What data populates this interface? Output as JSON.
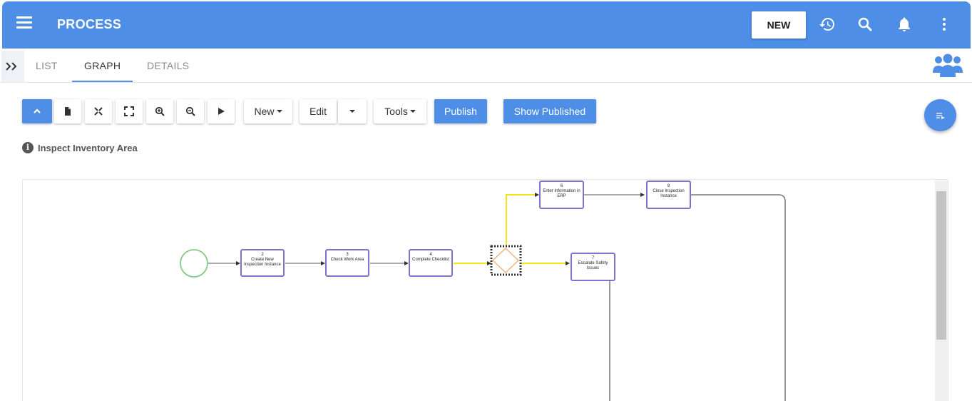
{
  "app": {
    "title": "PROCESS",
    "new_label": "NEW",
    "accent_color": "#4e8ee6",
    "icons": [
      "menu-icon",
      "history-icon",
      "search-icon",
      "bell-icon",
      "more-vert-icon"
    ]
  },
  "tabs": [
    {
      "label": "LIST",
      "active": false
    },
    {
      "label": "GRAPH",
      "active": true
    },
    {
      "label": "DETAILS",
      "active": false
    }
  ],
  "toolbar": {
    "new_label": "New",
    "edit_label": "Edit",
    "tools_label": "Tools",
    "publish_label": "Publish",
    "show_published_label": "Show Published",
    "icons": [
      "collapse-up-icon",
      "document-icon",
      "fit-icon",
      "fullscreen-icon",
      "zoom-in-icon",
      "zoom-out-icon",
      "play-icon"
    ]
  },
  "process_name": "Inspect Inventory Area",
  "nodes": [
    {
      "id": "2",
      "label": "Create New Inspection Instance"
    },
    {
      "id": "3",
      "label": "Check Work Area"
    },
    {
      "id": "4",
      "label": "Complete Checklist"
    },
    {
      "id": "6",
      "label": "Enter Information in ERP"
    },
    {
      "id": "8",
      "label": "Close Inspection Instance"
    },
    {
      "id": "7",
      "label": "Escalate Safety Issues"
    }
  ]
}
